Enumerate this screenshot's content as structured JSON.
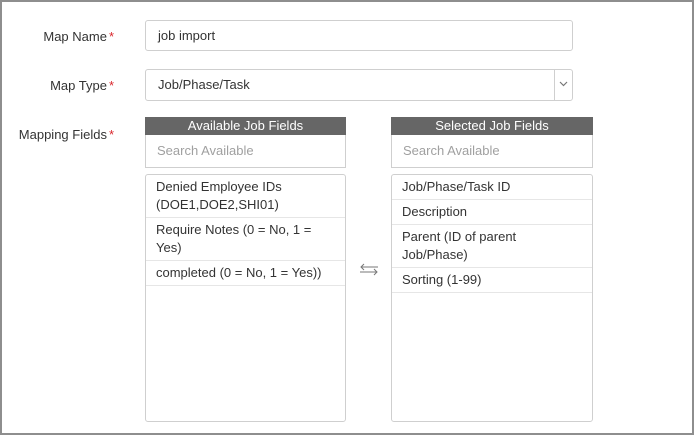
{
  "form": {
    "map_name": {
      "label": "Map Name",
      "required_mark": "*",
      "value": "job import"
    },
    "map_type": {
      "label": "Map Type",
      "required_mark": "*",
      "value": "Job/Phase/Task",
      "icon": "chevron-down-icon"
    },
    "mapping_fields": {
      "label": "Mapping Fields",
      "required_mark": "*"
    }
  },
  "available": {
    "title": "Available Job Fields",
    "search_placeholder": "Search Available",
    "items": [
      "Denied Employee IDs (DOE1,DOE2,SHI01)",
      "Require Notes (0 = No, 1 = Yes)",
      "completed (0 = No, 1 = Yes))"
    ]
  },
  "selected": {
    "title": "Selected Job Fields",
    "search_placeholder": "Search Available",
    "items": [
      "Job/Phase/Task ID",
      "Description",
      "Parent (ID of parent Job/Phase)",
      "Sorting (1-99)"
    ]
  },
  "swap_icon": "swap-arrows-icon",
  "colors": {
    "required": "#d9262c",
    "panel_header_bg": "#666666",
    "border": "#cfcfcf",
    "frame_border": "#8e8e8e",
    "placeholder": "#a0a0a0"
  }
}
